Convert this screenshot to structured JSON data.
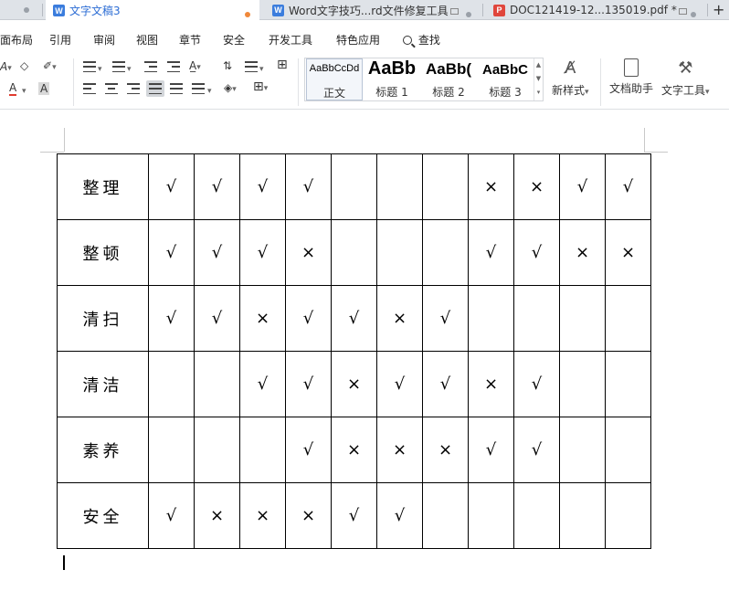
{
  "tabs": {
    "active_title": "文字文稿3",
    "tab2_title": "Word文字技巧...rd文件修复工具",
    "tab3_title": "DOC121419-12...135019.pdf *",
    "tab_icon_letter": "W",
    "add_label": "+"
  },
  "menu": {
    "items": [
      "面布局",
      "引用",
      "审阅",
      "视图",
      "章节",
      "安全",
      "开发工具",
      "特色应用"
    ],
    "search_label": "查找"
  },
  "ribbon": {
    "styles": [
      {
        "sample": "AaBbCcDd",
        "name": "正文"
      },
      {
        "sample": "AaBb",
        "name": "标题 1"
      },
      {
        "sample": "AaBb(",
        "name": "标题 2"
      },
      {
        "sample": "AaBbC",
        "name": "标题 3"
      }
    ],
    "new_style_label": "新样式",
    "doc_helper_label": "文档助手",
    "text_tools_label": "文字工具"
  },
  "table": {
    "rows": [
      {
        "label": "整理",
        "cells": [
          "√",
          "√",
          "√",
          "√",
          "",
          "",
          "",
          "×",
          "×",
          "√",
          "√"
        ]
      },
      {
        "label": "整顿",
        "cells": [
          "√",
          "√",
          "√",
          "×",
          "",
          "",
          "",
          "√",
          "√",
          "×",
          "×"
        ]
      },
      {
        "label": "清扫",
        "cells": [
          "√",
          "√",
          "×",
          "√",
          "√",
          "×",
          "√",
          "",
          "",
          "",
          ""
        ]
      },
      {
        "label": "清洁",
        "cells": [
          "",
          "",
          "√",
          "√",
          "×",
          "√",
          "√",
          "×",
          "√",
          "",
          ""
        ]
      },
      {
        "label": "素养",
        "cells": [
          "",
          "",
          "",
          "√",
          "×",
          "×",
          "×",
          "√",
          "√",
          "",
          ""
        ]
      },
      {
        "label": "安全",
        "cells": [
          "√",
          "×",
          "×",
          "×",
          "√",
          "√",
          "",
          "",
          "",
          "",
          ""
        ]
      }
    ]
  },
  "colors": {
    "active_tab_text": "#2b6cd4",
    "word_icon": "#3b7ddd",
    "pdf_icon": "#e0463c",
    "modified_dot": "#f0883a"
  }
}
